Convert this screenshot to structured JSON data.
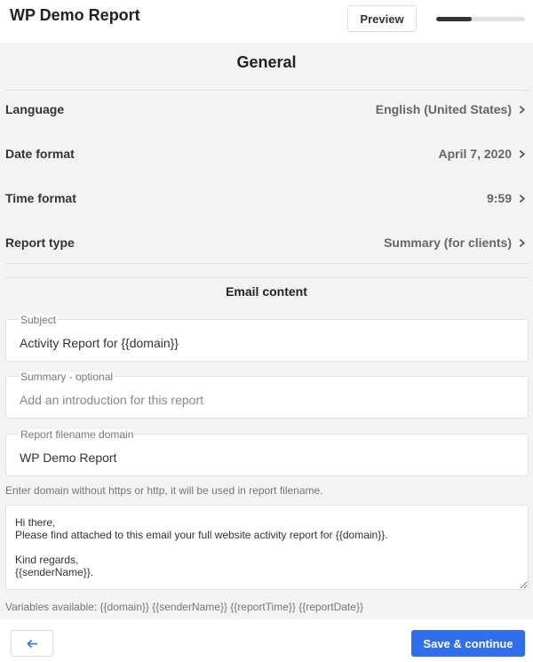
{
  "header": {
    "title": "WP Demo Report",
    "preview_label": "Preview",
    "progress_fraction": 0.4
  },
  "general": {
    "title": "General",
    "rows": [
      {
        "label": "Language",
        "value": "English (United States)",
        "icon": "chevron-right-icon"
      },
      {
        "label": "Date format",
        "value": "April 7, 2020",
        "icon": "chevron-right-icon"
      },
      {
        "label": "Time format",
        "value": "9:59",
        "icon": "chevron-right-icon"
      },
      {
        "label": "Report type",
        "value": "Summary (for clients)",
        "icon": "chevron-right-icon"
      }
    ]
  },
  "email": {
    "title": "Email content",
    "subject": {
      "label": "Subject",
      "value": "Activity Report for {{domain}}"
    },
    "summary": {
      "label": "Summary - optional",
      "placeholder": "Add an introduction for this report"
    },
    "filename": {
      "label": "Report filename domain",
      "value": "WP Demo Report",
      "helper": "Enter domain without https or http, it will be used in report filename."
    },
    "message": "Hi there,\nPlease find attached to this email your full website activity report for {{domain}}.\n\nKind regards,\n{{senderName}}.",
    "variables_text": "Variables available: {{domain}} {{senderName}} {{reportTime}} {{reportDate}}"
  },
  "footer": {
    "back_icon": "arrow-left-icon",
    "save_label": "Save & continue"
  },
  "colors": {
    "primary": "#2f6fec",
    "background": "#f3f3f3",
    "progress": "#333333"
  }
}
